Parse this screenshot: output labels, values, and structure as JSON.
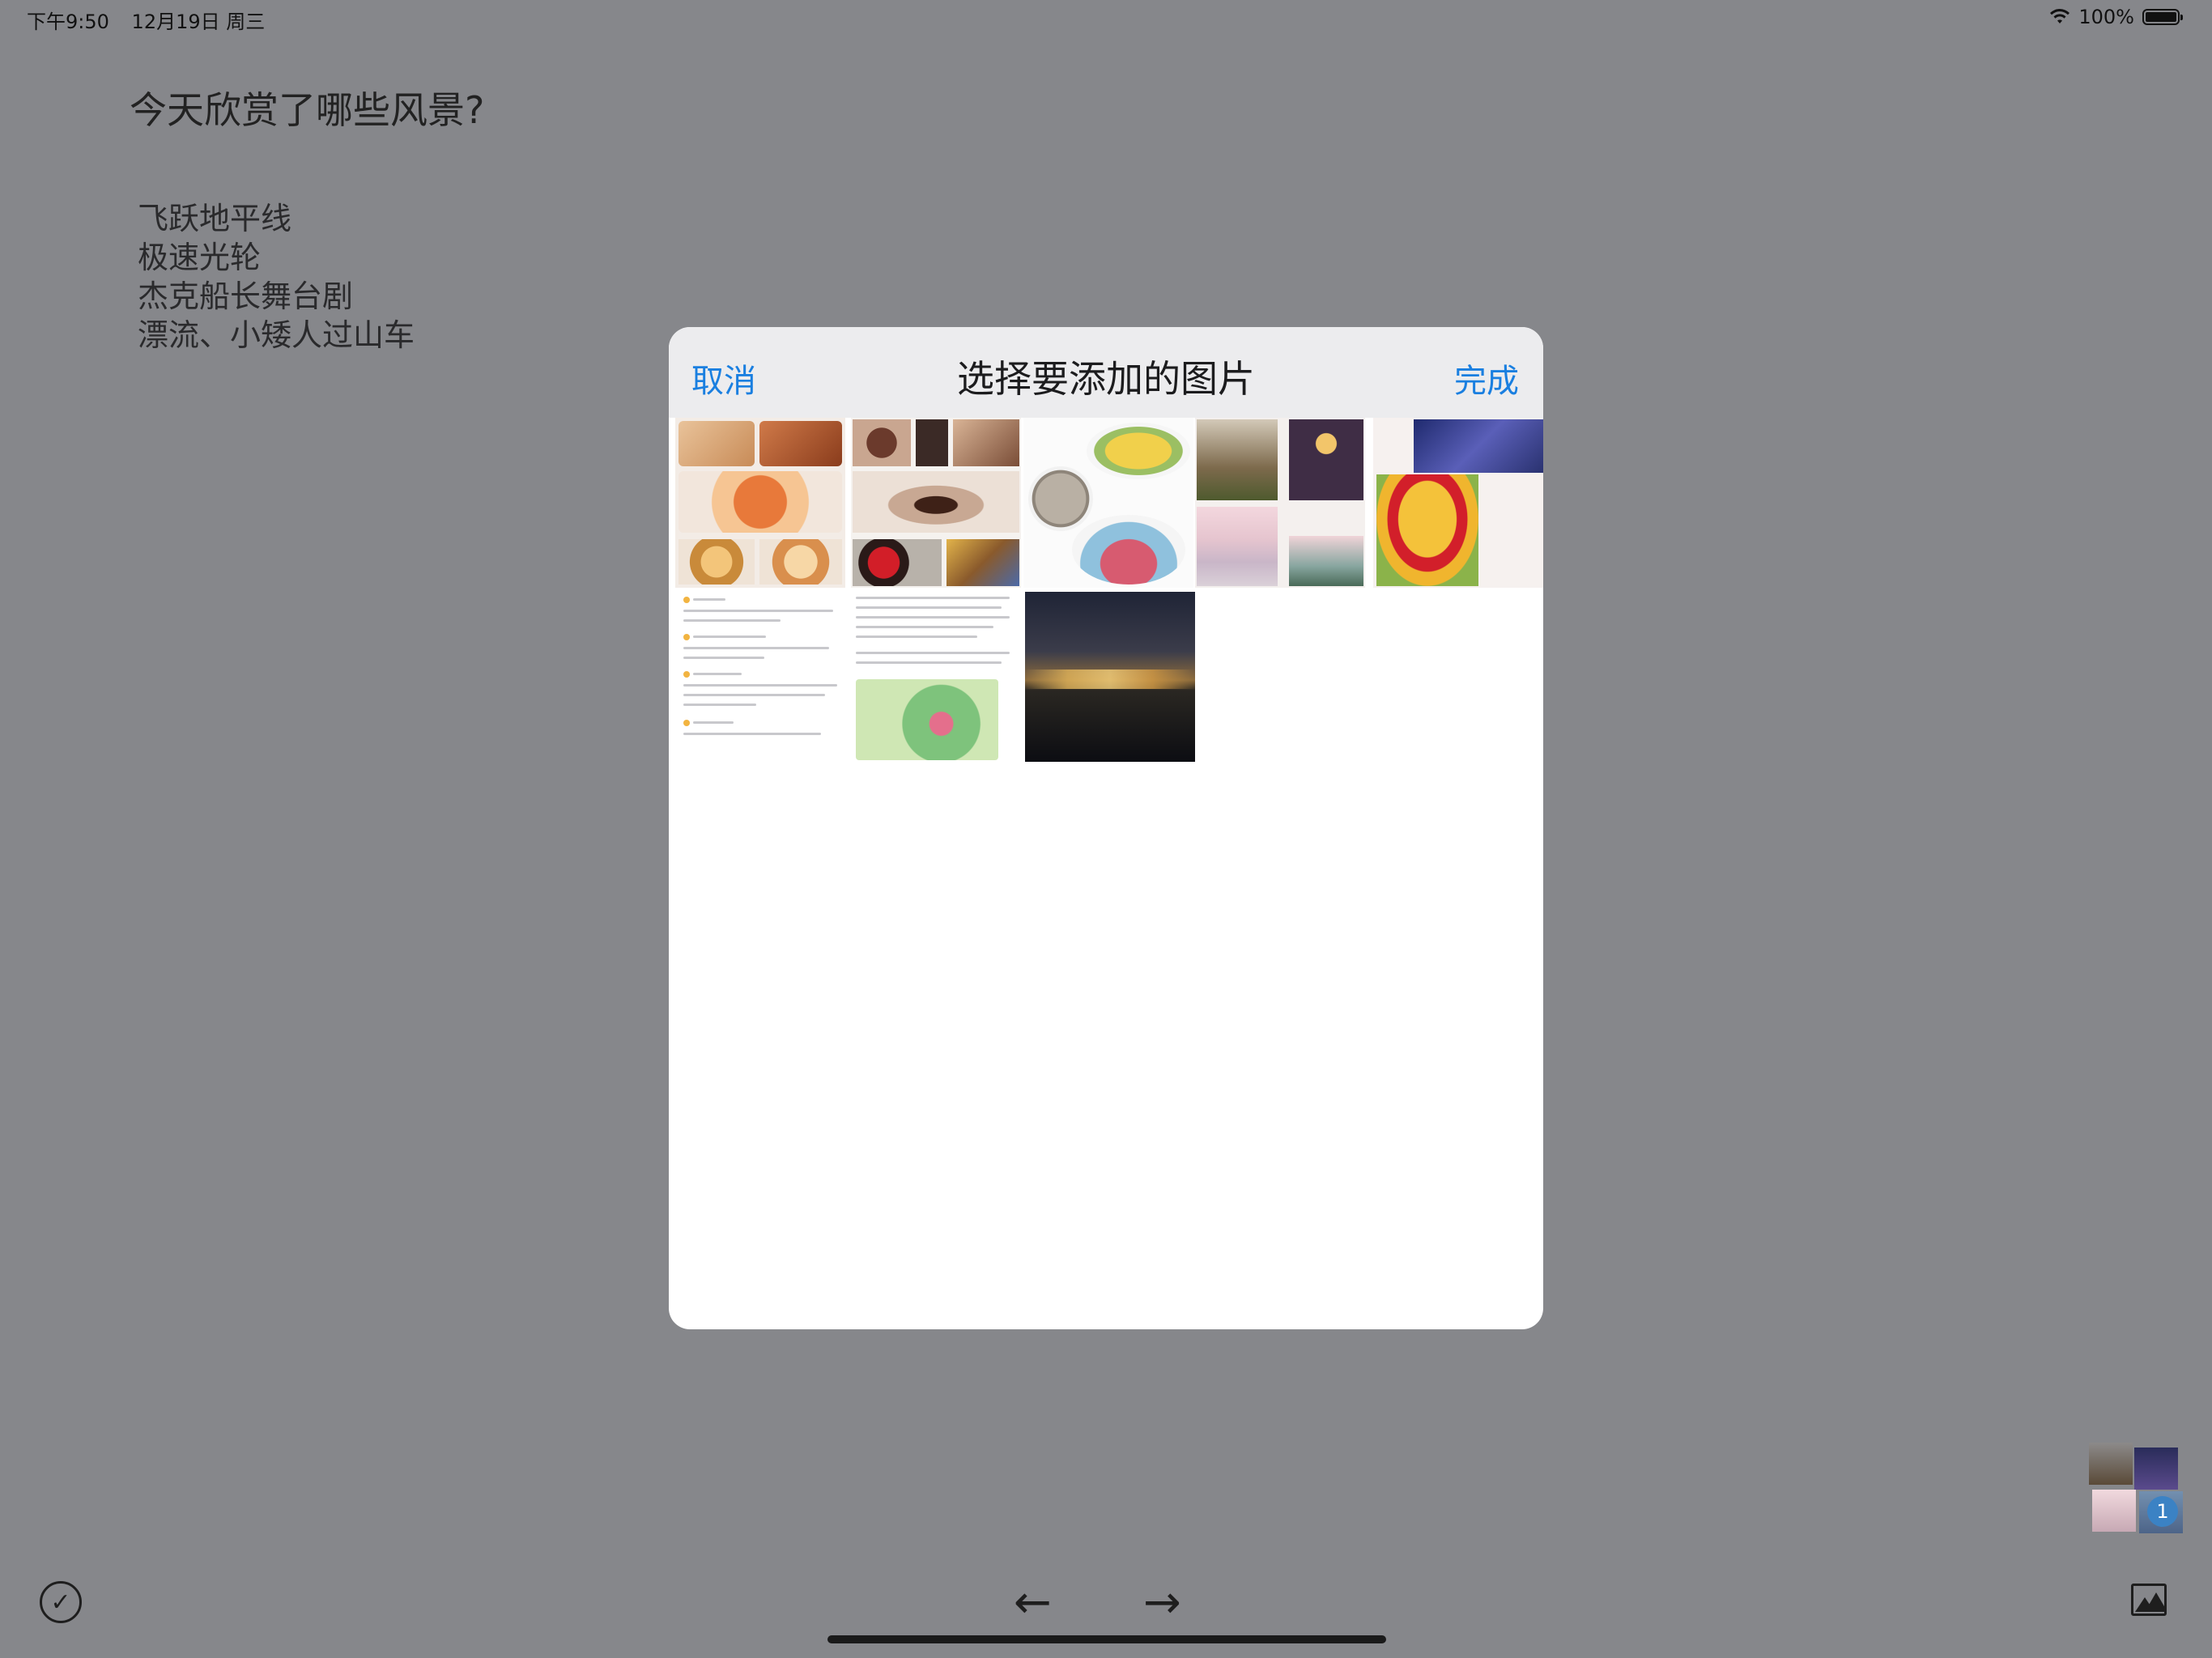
{
  "status_bar": {
    "time": "下午9:50",
    "date": "12月19日 周三",
    "battery": "100%"
  },
  "note": {
    "prompt": "今天欣赏了哪些风景?",
    "entries": [
      "飞跃地平线",
      "极速光轮",
      "杰克船长舞台剧",
      "漂流、小矮人过山车"
    ]
  },
  "picker": {
    "title": "选择要添加的图片",
    "cancel_label": "取消",
    "done_label": "完成"
  },
  "photo_stack": {
    "badge_count": "1"
  },
  "toolbar": {
    "back_arrow": "←",
    "forward_arrow": "→",
    "check_glyph": "✓"
  },
  "colors": {
    "accent": "#1a7fe0",
    "overlay_bg": "#86878b",
    "modal_header": "#ececee",
    "badge": "#3b82c4"
  }
}
